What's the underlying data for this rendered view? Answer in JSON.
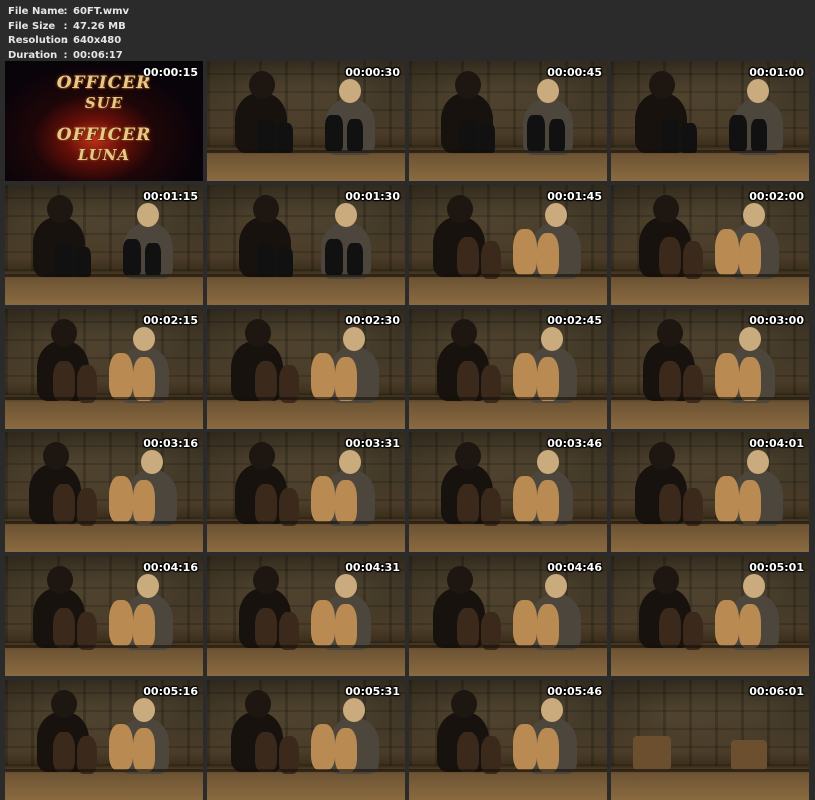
{
  "file_info": {
    "file_name_label": "File Name",
    "file_name": "60FT.wmv",
    "file_size_label": "File Size",
    "file_size": "47.26 MB",
    "resolution_label": "Resolution",
    "resolution": "640x480",
    "duration_label": "Duration",
    "duration": "00:06:17",
    "separator": ":"
  },
  "title_card": {
    "line1": "OFFICER",
    "line2": "SUE",
    "line3": "OFFICER",
    "line4": "LUNA"
  },
  "thumbnails": [
    {
      "time": "00:00:15",
      "kind": "title"
    },
    {
      "time": "00:00:30",
      "kind": "boots"
    },
    {
      "time": "00:00:45",
      "kind": "boots"
    },
    {
      "time": "00:01:00",
      "kind": "boots"
    },
    {
      "time": "00:01:15",
      "kind": "boots"
    },
    {
      "time": "00:01:30",
      "kind": "boots"
    },
    {
      "time": "00:01:45",
      "kind": "feet"
    },
    {
      "time": "00:02:00",
      "kind": "feet"
    },
    {
      "time": "00:02:15",
      "kind": "feet"
    },
    {
      "time": "00:02:30",
      "kind": "feet"
    },
    {
      "time": "00:02:45",
      "kind": "feet"
    },
    {
      "time": "00:03:00",
      "kind": "feet"
    },
    {
      "time": "00:03:16",
      "kind": "feet"
    },
    {
      "time": "00:03:31",
      "kind": "feet"
    },
    {
      "time": "00:03:46",
      "kind": "feet"
    },
    {
      "time": "00:04:01",
      "kind": "feet"
    },
    {
      "time": "00:04:16",
      "kind": "feet"
    },
    {
      "time": "00:04:31",
      "kind": "feet"
    },
    {
      "time": "00:04:46",
      "kind": "feet"
    },
    {
      "time": "00:05:01",
      "kind": "feet"
    },
    {
      "time": "00:05:16",
      "kind": "feet"
    },
    {
      "time": "00:05:31",
      "kind": "feet"
    },
    {
      "time": "00:05:46",
      "kind": "feet"
    },
    {
      "time": "00:06:01",
      "kind": "empty"
    }
  ]
}
